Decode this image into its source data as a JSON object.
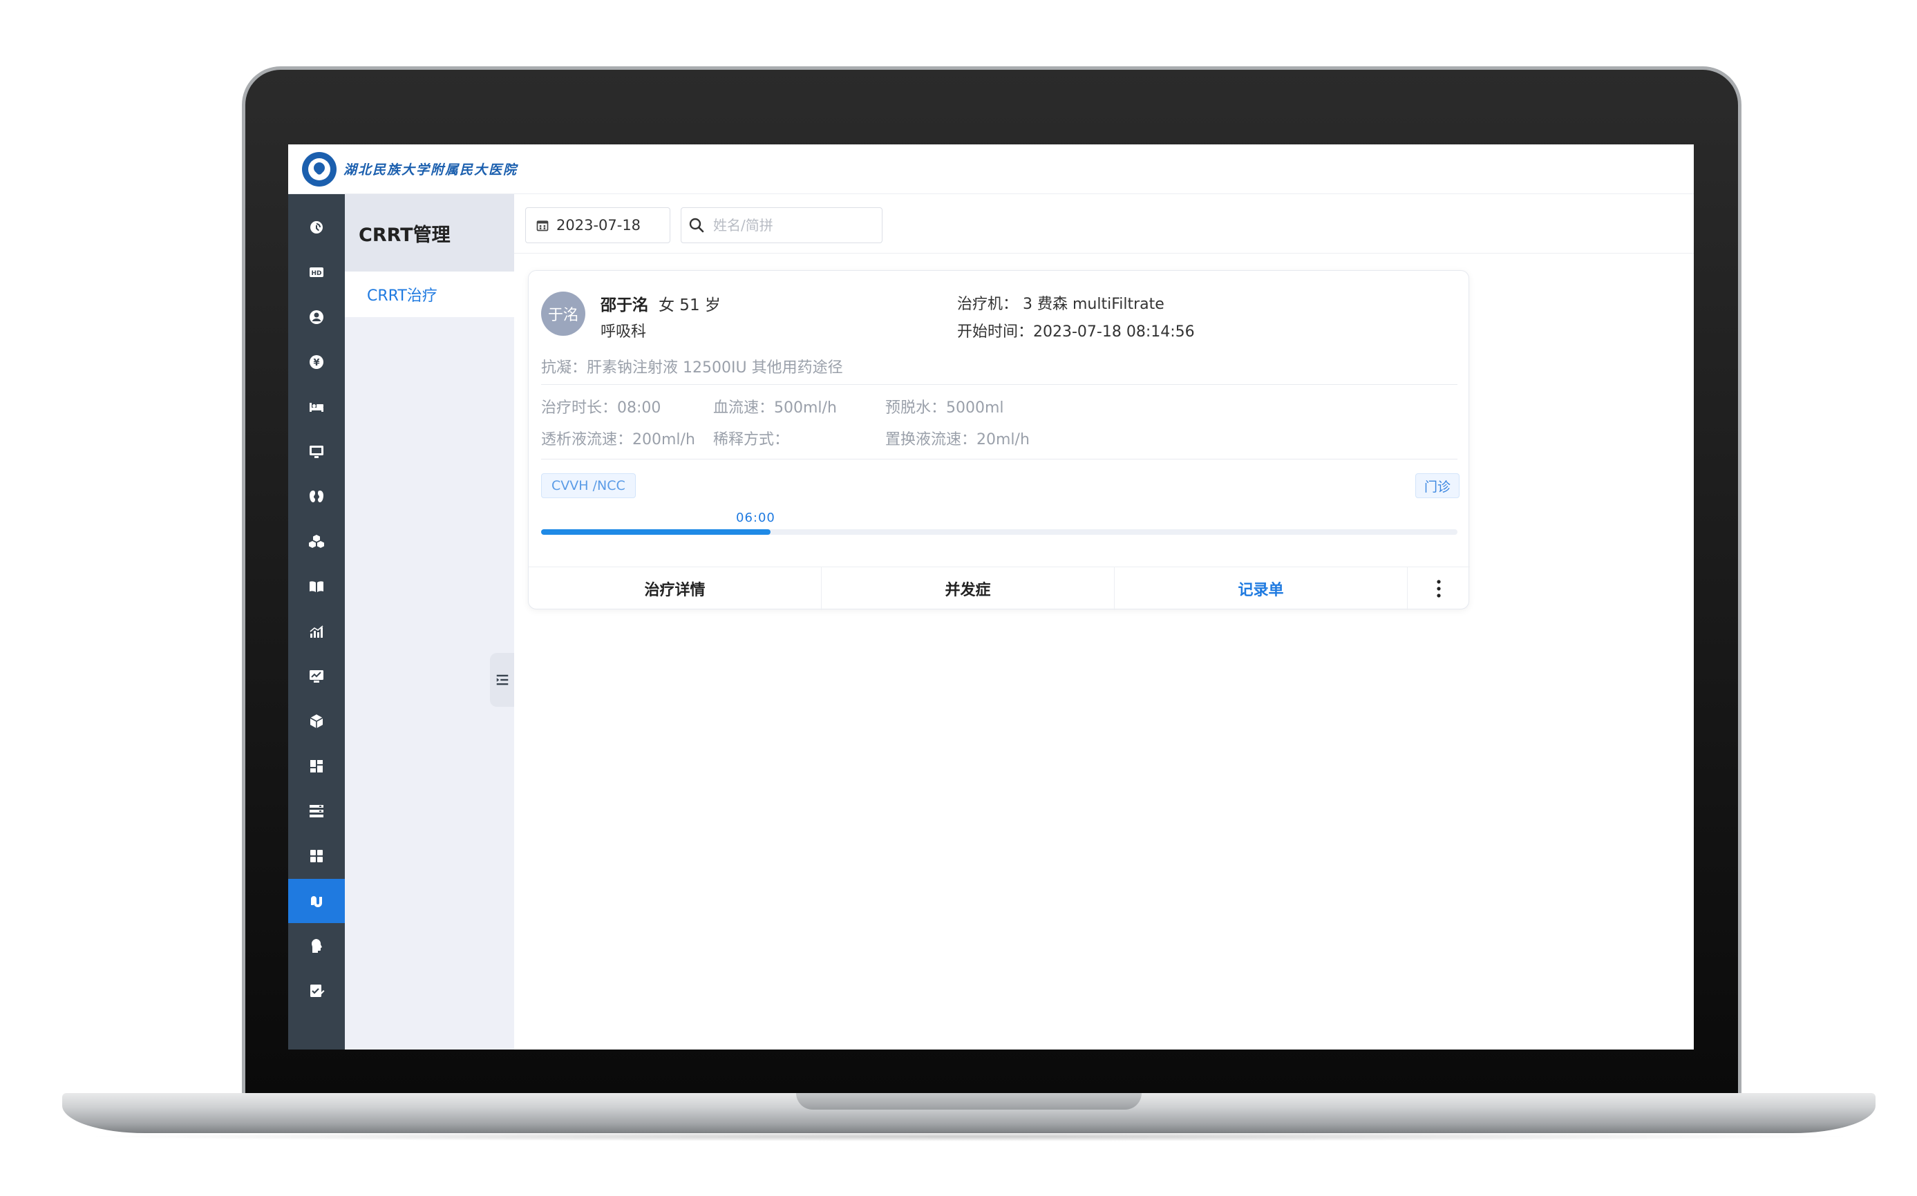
{
  "header": {
    "logo_text": "湖北民族大学附属民大医院"
  },
  "iconbar": {
    "items": [
      {
        "icon": "dashboard-icon"
      },
      {
        "icon": "hd-icon"
      },
      {
        "icon": "user-icon"
      },
      {
        "icon": "yen-icon"
      },
      {
        "icon": "bed-icon"
      },
      {
        "icon": "monitor-icon"
      },
      {
        "icon": "kidney-icon"
      },
      {
        "icon": "cubes-icon"
      },
      {
        "icon": "book-icon"
      },
      {
        "icon": "bar-chart-icon"
      },
      {
        "icon": "trend-monitor-icon"
      },
      {
        "icon": "box-icon"
      },
      {
        "icon": "layout-icon"
      },
      {
        "icon": "list-icon"
      },
      {
        "icon": "grid-icon"
      },
      {
        "icon": "crrt-icon",
        "active": true
      },
      {
        "icon": "head-icon"
      },
      {
        "icon": "edit-check-icon"
      }
    ],
    "active_color": "#1f7ae0",
    "bg_color": "#37424d"
  },
  "menu": {
    "title": "CRRT管理",
    "items": [
      {
        "label": "CRRT治疗",
        "active": true
      }
    ]
  },
  "filters": {
    "date": "2023-07-18",
    "search_placeholder": "姓名/简拼",
    "search_value": ""
  },
  "card": {
    "avatar_text": "于洺",
    "patient_name": "邵于洺",
    "gender_age": "女 51 岁",
    "department": "呼吸科",
    "machine": "治疗机： 3  费森 multiFiltrate",
    "start_time": "开始时间：2023-07-18 08:14:56",
    "anticoagulation": "抗凝：肝素钠注射液 12500IU 其他用药途径",
    "metrics": [
      {
        "text": "治疗时长：08:00"
      },
      {
        "text": "血流速：500ml/h"
      },
      {
        "text": "预脱水：5000ml"
      },
      {
        "text": "透析液流速：200ml/h"
      },
      {
        "text": "稀释方式："
      },
      {
        "text": "置换液流速：20ml/h"
      }
    ],
    "mode_tag": "CVVH /NCC",
    "visit_tag": "门诊",
    "progress": {
      "label": "06:00",
      "fraction": 0.25
    },
    "footer_buttons": [
      "治疗详情",
      "并发症",
      "记录单"
    ]
  },
  "colors": {
    "accent": "#1f7ae0",
    "muted_text": "#9aa0aa",
    "avatar_bg": "#9ba6bd"
  }
}
